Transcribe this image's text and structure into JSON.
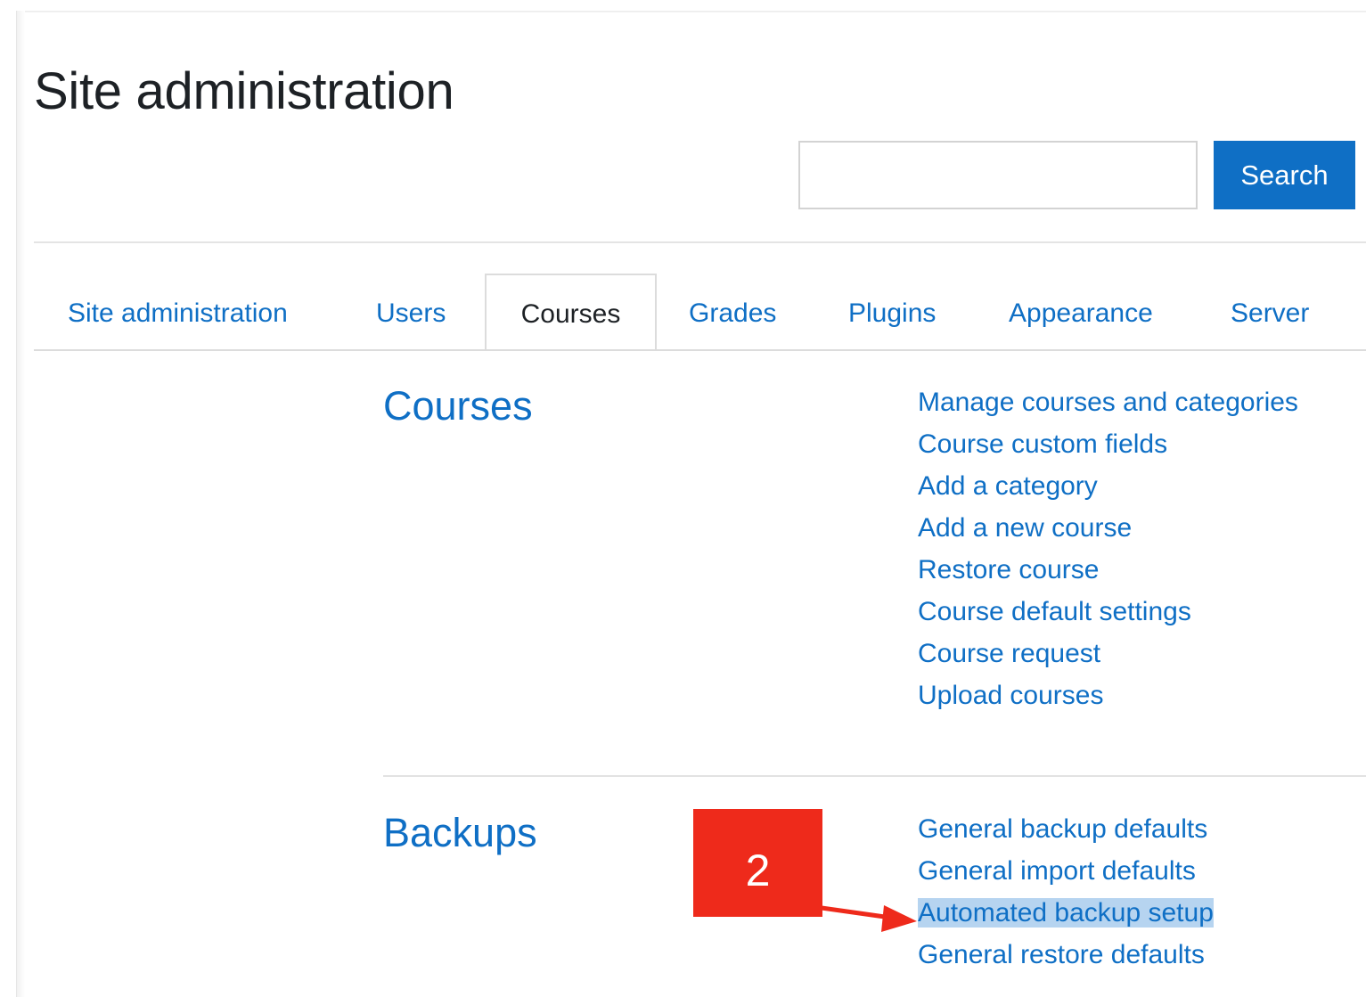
{
  "page": {
    "title": "Site administration"
  },
  "search": {
    "value": "",
    "placeholder": "",
    "button_label": "Search"
  },
  "tabs": [
    {
      "label": "Site administration",
      "active": false
    },
    {
      "label": "Users",
      "active": false
    },
    {
      "label": "Courses",
      "active": true
    },
    {
      "label": "Grades",
      "active": false
    },
    {
      "label": "Plugins",
      "active": false
    },
    {
      "label": "Appearance",
      "active": false
    },
    {
      "label": "Server",
      "active": false
    }
  ],
  "sections": [
    {
      "heading": "Courses",
      "links": [
        "Manage courses and categories",
        "Course custom fields",
        "Add a category",
        "Add a new course",
        "Restore course",
        "Course default settings",
        "Course request",
        "Upload courses"
      ]
    },
    {
      "heading": "Backups",
      "links": [
        "General backup defaults",
        "General import defaults",
        "Automated backup setup",
        "General restore defaults"
      ],
      "highlighted_link": "Automated backup setup"
    }
  ],
  "annotation": {
    "step_number": "2",
    "color": "#ee2a1b",
    "icon": "arrow-right-icon"
  },
  "colors": {
    "link": "#0f6fc5",
    "button": "#0f6fc5",
    "highlight": "#b6d4f0",
    "text": "#1d2125"
  }
}
